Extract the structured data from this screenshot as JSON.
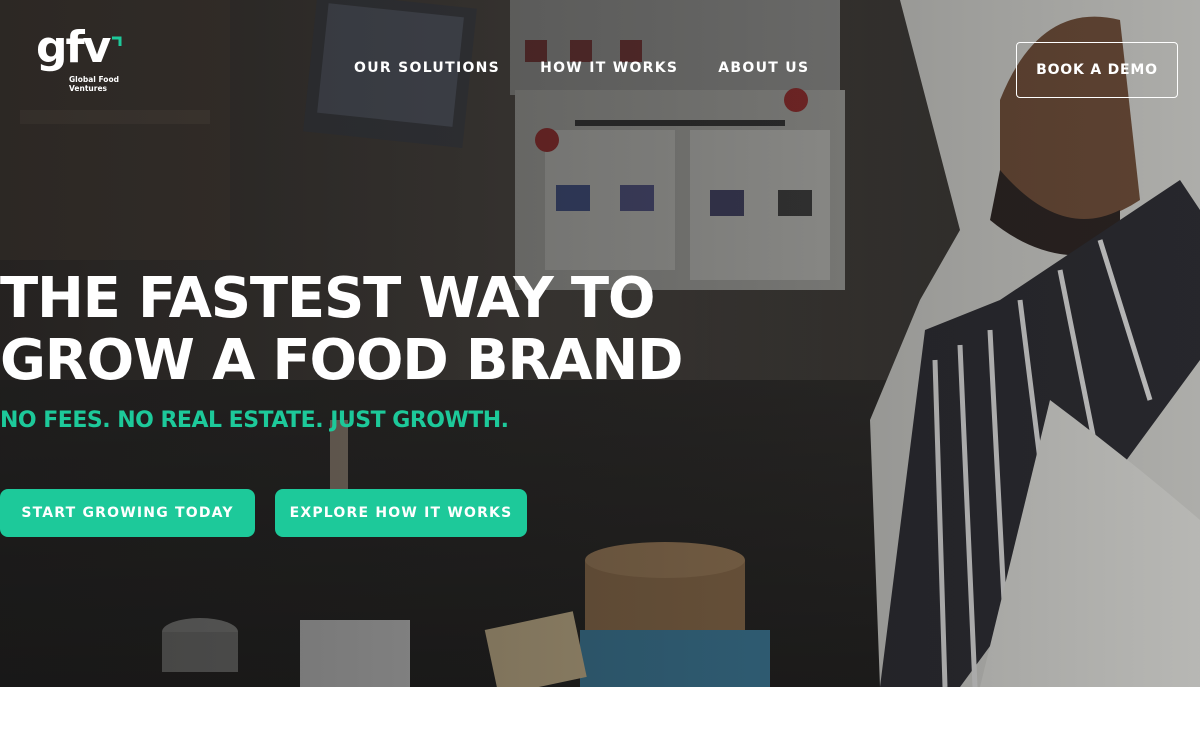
{
  "brand": {
    "logo_mark": "gfv",
    "logo_sub_line1": "Global Food",
    "logo_sub_line2": "Ventures",
    "accent_color": "#1dc99a"
  },
  "nav": {
    "items": [
      {
        "label": "OUR SOLUTIONS"
      },
      {
        "label": "HOW IT WORKS"
      },
      {
        "label": "ABOUT US"
      }
    ],
    "demo_label": "BOOK A DEMO"
  },
  "hero": {
    "headline_line1": "THE FASTEST WAY TO",
    "headline_line2": "GROW A FOOD BRAND",
    "tagline": "NO FEES. NO REAL ESTATE. JUST GROWTH.",
    "cta_primary": "START GROWING TODAY",
    "cta_secondary": "EXPLORE HOW IT WORKS"
  }
}
